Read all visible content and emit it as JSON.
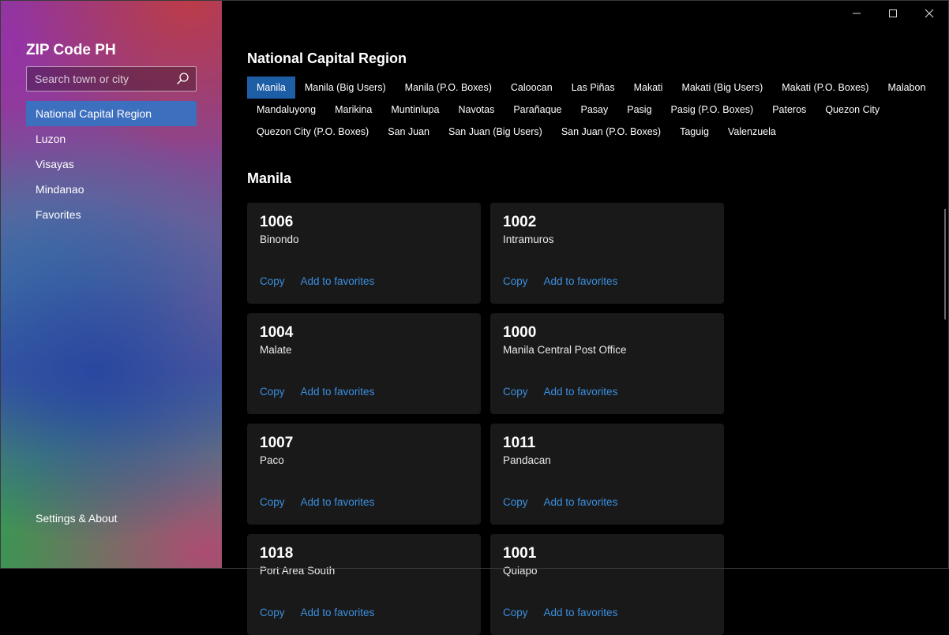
{
  "app": {
    "title": "ZIP Code PH"
  },
  "search": {
    "placeholder": "Search town or city"
  },
  "nav": {
    "items": [
      {
        "label": "National Capital Region",
        "active": true
      },
      {
        "label": "Luzon"
      },
      {
        "label": "Visayas"
      },
      {
        "label": "Mindanao"
      },
      {
        "label": "Favorites"
      }
    ],
    "settings_label": "Settings & About"
  },
  "icons": {
    "search": "search-icon",
    "minimize": "minimize-icon",
    "maximize": "maximize-icon",
    "close": "close-icon"
  },
  "colors": {
    "accent": "#3d6fbf",
    "chip_active": "#1e5ea6",
    "link": "#3b8fe0",
    "card_bg": "#191919"
  },
  "region": {
    "title": "National Capital Region"
  },
  "cities": {
    "row1": [
      "Manila",
      "Manila (Big Users)",
      "Manila (P.O. Boxes)",
      "Caloocan",
      "Las Piñas",
      "Makati",
      "Makati (Big Users)",
      "Makati (P.O. Boxes)",
      "Malabon"
    ],
    "row2": [
      "Mandaluyong",
      "Marikina",
      "Muntinlupa",
      "Navotas",
      "Parañaque",
      "Pasay",
      "Pasig",
      "Pasig (P.O. Boxes)",
      "Pateros",
      "Quezon City"
    ],
    "row3": [
      "Quezon City (P.O. Boxes)",
      "San Juan",
      "San Juan (Big Users)",
      "San Juan (P.O. Boxes)",
      "Taguig",
      "Valenzuela"
    ],
    "selected": "Manila"
  },
  "section": {
    "title": "Manila"
  },
  "actions": {
    "copy": "Copy",
    "favorite": "Add to favorites"
  },
  "cards": [
    {
      "zip": "1006",
      "place": "Binondo"
    },
    {
      "zip": "1002",
      "place": "Intramuros"
    },
    {
      "zip": "1004",
      "place": "Malate"
    },
    {
      "zip": "1000",
      "place": "Manila Central Post Office"
    },
    {
      "zip": "1007",
      "place": "Paco"
    },
    {
      "zip": "1011",
      "place": "Pandacan"
    },
    {
      "zip": "1018",
      "place": "Port Area South"
    },
    {
      "zip": "1001",
      "place": "Quiapo"
    }
  ]
}
